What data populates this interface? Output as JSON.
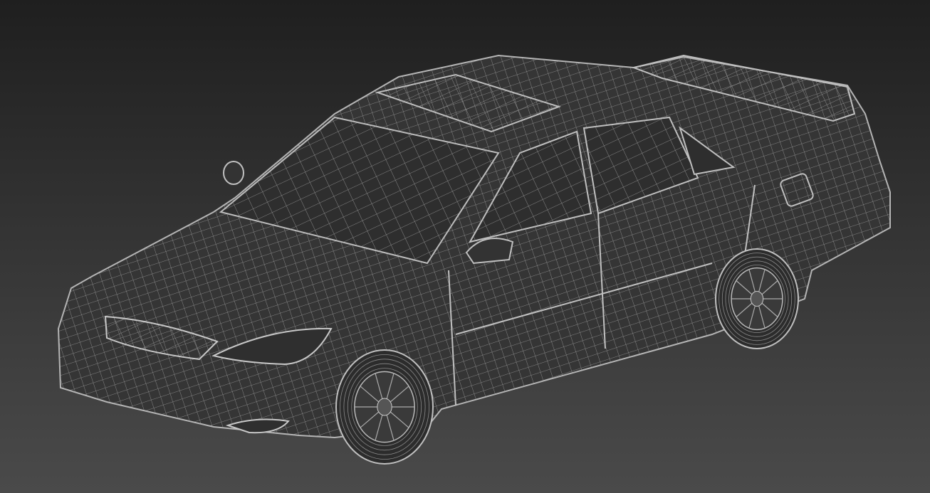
{
  "colors": {
    "background_top": "#1f1f1f",
    "background_bottom": "#4a4a4a",
    "wire": "#a8a8a8",
    "body_fill": "#3a3a3a"
  }
}
